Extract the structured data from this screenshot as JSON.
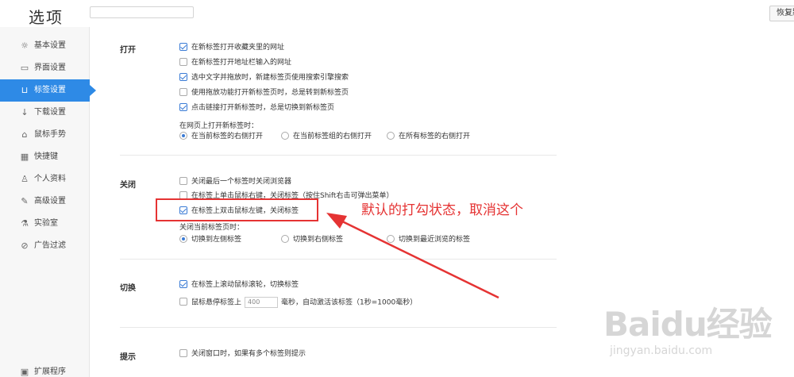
{
  "header": {
    "title": "选项",
    "search_placeholder": "",
    "restore_label": "恢复默认"
  },
  "sidebar": {
    "items": [
      {
        "label": "基本设置",
        "icon": "gear-icon",
        "glyph": "☼"
      },
      {
        "label": "界面设置",
        "icon": "window-icon",
        "glyph": "▭"
      },
      {
        "label": "标签设置",
        "icon": "tab-icon",
        "glyph": "⊔",
        "active": true
      },
      {
        "label": "下载设置",
        "icon": "download-icon",
        "glyph": "↓"
      },
      {
        "label": "鼠标手势",
        "icon": "mouse-icon",
        "glyph": "⌂"
      },
      {
        "label": "快捷键",
        "icon": "keyboard-icon",
        "glyph": "▦"
      },
      {
        "label": "个人资料",
        "icon": "user-icon",
        "glyph": "♙"
      },
      {
        "label": "高级设置",
        "icon": "wrench-icon",
        "glyph": "✎"
      },
      {
        "label": "实验室",
        "icon": "flask-icon",
        "glyph": "⚗"
      },
      {
        "label": "广告过滤",
        "icon": "block-icon",
        "glyph": "⊘"
      },
      {
        "label": "扩展程序",
        "icon": "extension-icon",
        "glyph": "▣"
      }
    ]
  },
  "sections": {
    "open": {
      "title": "打开",
      "options": [
        {
          "label": "在新标签打开收藏夹里的网址",
          "checked": true
        },
        {
          "label": "在新标签打开地址栏输入的网址",
          "checked": false
        },
        {
          "label": "选中文字并拖放时，新建标签页使用搜索引擎搜索",
          "checked": true
        },
        {
          "label": "使用拖放功能打开新标签页时，总是转到新标签页",
          "checked": false
        },
        {
          "label": "点击链接打开新标签时，总是切换到新标签页",
          "checked": true
        }
      ],
      "sub_label": "在网页上打开新标签时：",
      "radios": [
        {
          "label": "在当前标签的右侧打开",
          "checked": true
        },
        {
          "label": "在当前标签组的右侧打开",
          "checked": false
        },
        {
          "label": "在所有标签的右侧打开",
          "checked": false
        }
      ]
    },
    "close": {
      "title": "关闭",
      "options": [
        {
          "label": "关闭最后一个标签时关闭浏览器",
          "checked": false
        },
        {
          "label": "在标签上单击鼠标右键，关闭标签（按住Shift右击可弹出菜单）",
          "checked": false
        },
        {
          "label": "在标签上双击鼠标左键，关闭标签",
          "checked": true
        }
      ],
      "sub_label": "关闭当前标签页时：",
      "radios": [
        {
          "label": "切换到左侧标签",
          "checked": true
        },
        {
          "label": "切换到右侧标签",
          "checked": false
        },
        {
          "label": "切换到最近浏览的标签",
          "checked": false
        }
      ]
    },
    "switch": {
      "title": "切换",
      "option1": {
        "label": "在标签上滚动鼠标滚轮，切换标签",
        "checked": true
      },
      "option2_prefix": "鼠标悬停标签上",
      "option2_value": "400",
      "option2_suffix": "毫秒，自动激活该标签（1秒=1000毫秒）",
      "option2_checked": false
    },
    "prompt": {
      "title": "提示",
      "option": {
        "label": "关闭窗口时，如果有多个标签则提示",
        "checked": false
      }
    }
  },
  "annotation": {
    "text": "默认的打勾状态，取消这个",
    "color": "#e53333"
  },
  "watermark": {
    "logo": "Baidu经验",
    "url": "jingyan.baidu.com"
  }
}
